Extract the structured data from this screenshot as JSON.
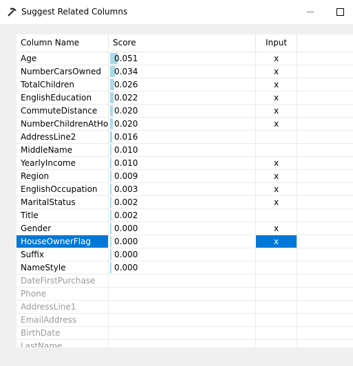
{
  "window": {
    "title": "Suggest Related Columns"
  },
  "table": {
    "headers": {
      "name": "Column Name",
      "score": "Score",
      "input": "Input"
    },
    "bar_color": "#add8e6",
    "selection_color": "#0078d7",
    "rows": [
      {
        "name": "Age",
        "score": "0.051",
        "score_value": 0.051,
        "input": "x",
        "state": "normal"
      },
      {
        "name": "NumberCarsOwned",
        "score": "0.034",
        "score_value": 0.034,
        "input": "x",
        "state": "normal"
      },
      {
        "name": "TotalChildren",
        "score": "0.026",
        "score_value": 0.026,
        "input": "x",
        "state": "normal"
      },
      {
        "name": "EnglishEducation",
        "score": "0.022",
        "score_value": 0.022,
        "input": "x",
        "state": "normal"
      },
      {
        "name": "CommuteDistance",
        "score": "0.020",
        "score_value": 0.02,
        "input": "x",
        "state": "normal"
      },
      {
        "name": "NumberChildrenAtHo...",
        "score": "0.020",
        "score_value": 0.02,
        "input": "x",
        "state": "normal"
      },
      {
        "name": "AddressLine2",
        "score": "0.016",
        "score_value": 0.016,
        "input": "",
        "state": "normal"
      },
      {
        "name": "MiddleName",
        "score": "0.010",
        "score_value": 0.01,
        "input": "",
        "state": "normal"
      },
      {
        "name": "YearlyIncome",
        "score": "0.010",
        "score_value": 0.01,
        "input": "x",
        "state": "normal"
      },
      {
        "name": "Region",
        "score": "0.009",
        "score_value": 0.009,
        "input": "x",
        "state": "normal"
      },
      {
        "name": "EnglishOccupation",
        "score": "0.003",
        "score_value": 0.003,
        "input": "x",
        "state": "normal"
      },
      {
        "name": "MaritalStatus",
        "score": "0.002",
        "score_value": 0.002,
        "input": "x",
        "state": "normal"
      },
      {
        "name": "Title",
        "score": "0.002",
        "score_value": 0.002,
        "input": "",
        "state": "normal"
      },
      {
        "name": "Gender",
        "score": "0.000",
        "score_value": 0.0,
        "input": "x",
        "state": "normal"
      },
      {
        "name": "HouseOwnerFlag",
        "score": "0.000",
        "score_value": 0.0,
        "input": "x",
        "state": "selected"
      },
      {
        "name": "Suffix",
        "score": "0.000",
        "score_value": 0.0,
        "input": "",
        "state": "normal"
      },
      {
        "name": "NameStyle",
        "score": "0.000",
        "score_value": 0.0,
        "input": "",
        "state": "normal"
      },
      {
        "name": "DateFirstPurchase",
        "score": "",
        "score_value": 0.0,
        "input": "",
        "state": "disabled"
      },
      {
        "name": "Phone",
        "score": "",
        "score_value": 0.0,
        "input": "",
        "state": "disabled"
      },
      {
        "name": "AddressLine1",
        "score": "",
        "score_value": 0.0,
        "input": "",
        "state": "disabled"
      },
      {
        "name": "EmailAddress",
        "score": "",
        "score_value": 0.0,
        "input": "",
        "state": "disabled"
      },
      {
        "name": "BirthDate",
        "score": "",
        "score_value": 0.0,
        "input": "",
        "state": "disabled"
      },
      {
        "name": "LastName",
        "score": "",
        "score_value": 0.0,
        "input": "",
        "state": "disabled"
      }
    ]
  }
}
